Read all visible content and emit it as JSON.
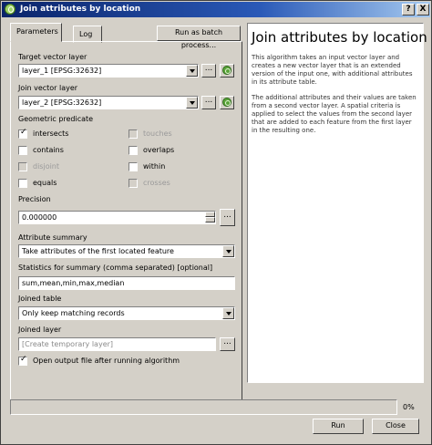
{
  "window": {
    "title": "Join attributes by location",
    "help_glyph": "?",
    "close_glyph": "X"
  },
  "tabs": [
    {
      "label": "Parameters",
      "active": true
    },
    {
      "label": "Log",
      "active": false
    }
  ],
  "batch_button": "Run as batch process...",
  "params": {
    "target_layer": {
      "label": "Target vector layer",
      "value": "layer_1 [EPSG:32632]"
    },
    "join_layer": {
      "label": "Join vector layer",
      "value": "layer_2 [EPSG:32632]"
    },
    "predicate": {
      "label": "Geometric predicate",
      "options": [
        {
          "label": "intersects",
          "checked": true,
          "enabled": true
        },
        {
          "label": "touches",
          "checked": false,
          "enabled": false
        },
        {
          "label": "contains",
          "checked": false,
          "enabled": true
        },
        {
          "label": "overlaps",
          "checked": false,
          "enabled": true
        },
        {
          "label": "disjoint",
          "checked": false,
          "enabled": false
        },
        {
          "label": "within",
          "checked": false,
          "enabled": true
        },
        {
          "label": "equals",
          "checked": false,
          "enabled": true
        },
        {
          "label": "crosses",
          "checked": false,
          "enabled": false
        }
      ]
    },
    "precision": {
      "label": "Precision",
      "value": "0.000000"
    },
    "attribute_summary": {
      "label": "Attribute summary",
      "value": "Take attributes of the first located feature"
    },
    "statistics": {
      "label": "Statistics for summary (comma separated) [optional]",
      "value": "sum,mean,min,max,median"
    },
    "joined_table": {
      "label": "Joined table",
      "value": "Only keep matching records"
    },
    "joined_layer": {
      "label": "Joined layer",
      "placeholder": "[Create temporary layer]"
    },
    "open_output": {
      "label": "Open output file after running algorithm",
      "checked": true
    },
    "browse_label": "..."
  },
  "help": {
    "title": "Join attributes by location",
    "paragraph1": "This algorithm takes an input vector layer and creates a new vector layer that is an extended version of the input one, with additional attributes in its attribute table.",
    "paragraph2": "The additional attributes and their values are taken from a second vector layer. A spatial criteria is applied to select the values from the second layer that are added to each feature from the first layer in the resulting one."
  },
  "progress": {
    "value": 0,
    "text": "0%"
  },
  "buttons": {
    "run": "Run",
    "close": "Close"
  }
}
